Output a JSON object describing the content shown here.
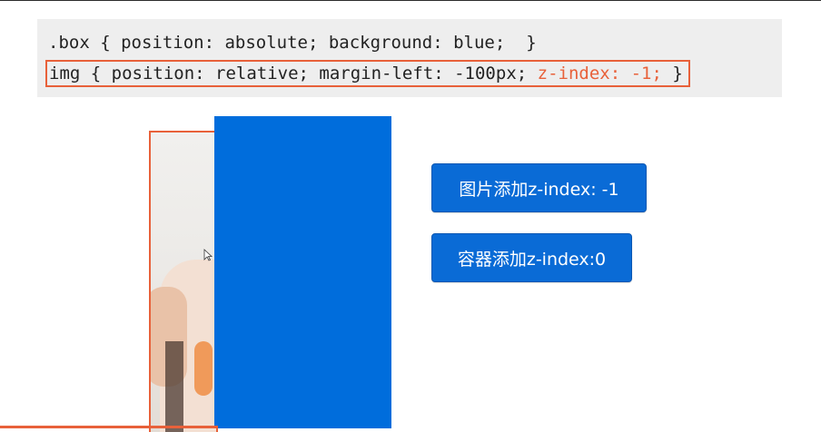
{
  "code": {
    "line1": ".box { position: absolute; background: blue;  }",
    "line2_prefix": "img { position: relative; margin-left: -100px; ",
    "line2_highlight": "z-index: -1;",
    "line2_suffix": " }"
  },
  "buttons": {
    "image_zindex": "图片添加z-index: -1",
    "container_zindex": "容器添加z-index:0"
  },
  "colors": {
    "accent": "#e8613a",
    "box_blue": "#006ddc",
    "button_blue": "#0a6bd6"
  },
  "icons": {
    "cursor": "cursor-icon"
  }
}
